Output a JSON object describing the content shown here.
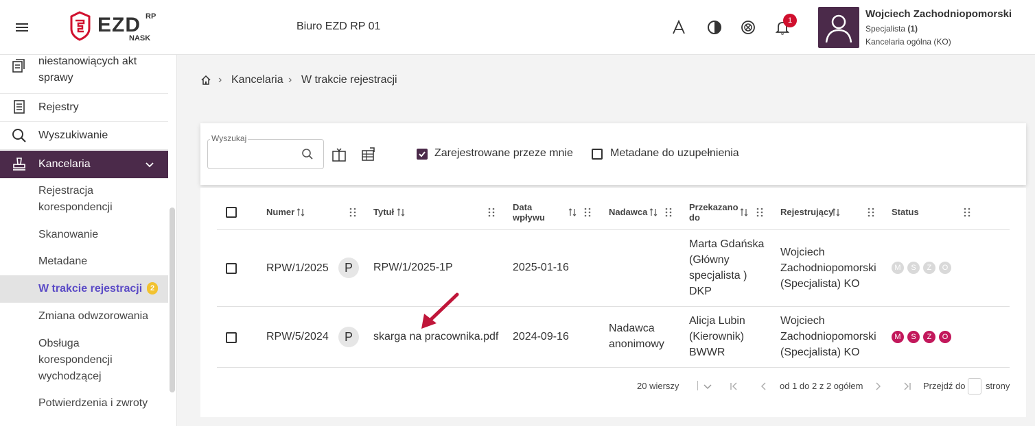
{
  "header": {
    "unit_title": "Biuro EZD RP 01",
    "notification_count": "1",
    "user": {
      "name": "Wojciech Zachodniopomorski",
      "role": "Specjalista",
      "role_count": "(1)",
      "department": "Kancelaria ogólna (KO)"
    }
  },
  "logo": {
    "text": "EZD",
    "sup": "RP",
    "sub": "NASK",
    "color": "#d0102e"
  },
  "sidebar": {
    "items": [
      {
        "label_line1": "niestanowiących akt",
        "label_line2": "sprawy",
        "icon": "documents-icon"
      },
      {
        "label": "Rejestry",
        "icon": "register-icon"
      },
      {
        "label": "Wyszukiwanie",
        "icon": "search-icon"
      },
      {
        "label": "Kancelaria",
        "icon": "stamp-icon"
      }
    ],
    "subitems": [
      {
        "label_line1": "Rejestracja",
        "label_line2": "korespondencji"
      },
      {
        "label": "Skanowanie"
      },
      {
        "label": "Metadane"
      },
      {
        "label": "W trakcie rejestracji",
        "count": "2"
      },
      {
        "label": "Zmiana odwzorowania"
      },
      {
        "label_line1": "Obsługa",
        "label_line2": "korespondencji",
        "label_line3": "wychodzącej"
      },
      {
        "label": "Potwierdzenia i zwroty"
      }
    ]
  },
  "breadcrumb": {
    "home_icon": "home-icon",
    "sep": "›",
    "items": [
      "Kancelaria",
      "W trakcie rejestracji"
    ]
  },
  "toolbar": {
    "search_label": "Wyszukaj",
    "filter1": "Zarejestrowane przeze mnie",
    "filter1_checked": true,
    "filter2": "Metadane do uzupełnienia",
    "filter2_checked": false
  },
  "table": {
    "columns": {
      "numer": "Numer",
      "tytul": "Tytuł",
      "data_line1": "Data",
      "data_line2": "wpływu",
      "nadawca": "Nadawca",
      "przekazano_line1": "Przekazano",
      "przekazano_line2": "do",
      "rejestrujacy": "Rejestrujący",
      "status": "Status"
    },
    "rows": [
      {
        "numer": "RPW/1/2025",
        "p": "P",
        "tytul": "RPW/1/2025-1P",
        "data": "2025-01-16",
        "nadawca_line1": "",
        "nadawca_line2": "",
        "przekazano": [
          "Marta Gdańska",
          "(Główny",
          "specjalista )",
          "DKP"
        ],
        "rejestrujacy": [
          "Wojciech",
          "Zachodniopomorski",
          "(Specjalista) KO"
        ],
        "status": [
          "M",
          "S",
          "Z",
          "O"
        ],
        "status_active": false
      },
      {
        "numer": "RPW/5/2024",
        "p": "P",
        "tytul": "skarga na pracownika.pdf",
        "data": "2024-09-16",
        "nadawca_line1": "Nadawca",
        "nadawca_line2": "anonimowy",
        "przekazano": [
          "Alicja Lubin",
          "(Kierownik)",
          "BWWR"
        ],
        "rejestrujacy": [
          "Wojciech",
          "Zachodniopomorski",
          "(Specjalista) KO"
        ],
        "status": [
          "M",
          "S",
          "Z",
          "O"
        ],
        "status_active": true
      }
    ]
  },
  "pager": {
    "rows_per_page": "20 wierszy",
    "range": "od 1 do 2 z 2 ogółem",
    "goto_label": "Przejdź do",
    "goto_suffix": "strony"
  },
  "colors": {
    "primary": "#4b2a4a",
    "accent": "#d0102e",
    "status_active": "#c2185b",
    "status_inactive": "#d9d9d9",
    "arrow": "#c0163a"
  }
}
